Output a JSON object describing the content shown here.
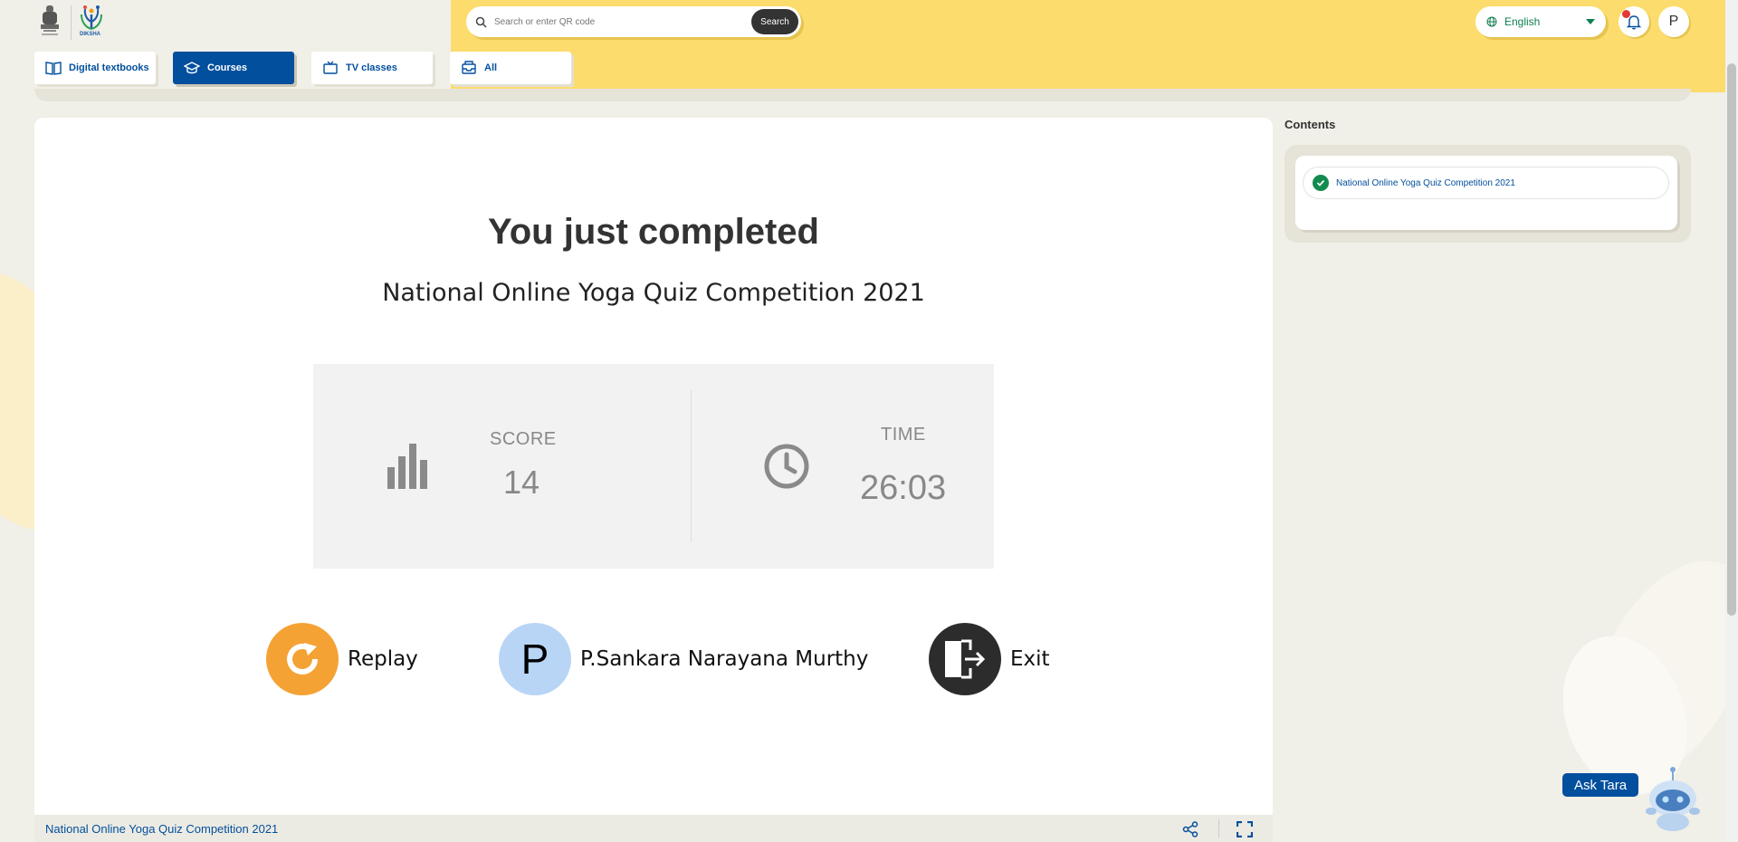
{
  "header": {
    "logo_text": "DIKSHA",
    "tabs": [
      {
        "label": "Digital textbooks",
        "icon": "book-icon",
        "active": false
      },
      {
        "label": "Courses",
        "icon": "graduation-cap-icon",
        "active": true
      },
      {
        "label": "TV classes",
        "icon": "tv-icon",
        "active": false
      },
      {
        "label": "All",
        "icon": "inbox-icon",
        "active": false
      }
    ],
    "search": {
      "placeholder": "Search or enter QR code",
      "button_label": "Search"
    },
    "language": "English",
    "user_initial": "P",
    "colors": {
      "banner": "#fcdc6c",
      "brand_blue": "#024f9d"
    }
  },
  "player": {
    "heading": "You just completed",
    "content_name": "National Online Yoga Quiz Competition 2021",
    "score_label": "SCORE",
    "score_value": "14",
    "time_label": "TIME",
    "time_value": "26:03",
    "actions": {
      "replay_label": "Replay",
      "user_initial": "P",
      "user_name": "P.Sankara Narayana Murthy",
      "exit_label": "Exit"
    },
    "footer_title": "National Online Yoga Quiz Competition 2021"
  },
  "contents": {
    "heading": "Contents",
    "items": [
      {
        "label": "National Online Yoga Quiz Competition 2021",
        "status": "completed"
      }
    ]
  },
  "assistant": {
    "label": "Ask Tara"
  }
}
